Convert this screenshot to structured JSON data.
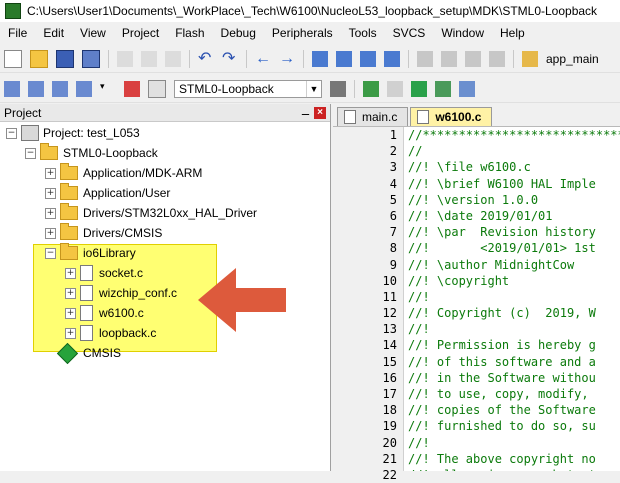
{
  "title": "C:\\Users\\User1\\Documents\\_WorkPlace\\_Tech\\W6100\\NucleoL53_loopback_setup\\MDK\\STML0-Loopback",
  "menu": [
    "File",
    "Edit",
    "View",
    "Project",
    "Flash",
    "Debug",
    "Peripherals",
    "Tools",
    "SVCS",
    "Window",
    "Help"
  ],
  "toolbar": {
    "function_label": "app_main"
  },
  "target": {
    "selected": "STML0-Loopback"
  },
  "panel": {
    "title": "Project",
    "pin": "\u0001",
    "close": "x"
  },
  "tree": {
    "project": "Project: test_L053",
    "target": "STML0-Loopback",
    "groups": [
      "Application/MDK-ARM",
      "Application/User",
      "Drivers/STM32L0xx_HAL_Driver",
      "Drivers/CMSIS",
      "io6Library"
    ],
    "files": [
      "socket.c",
      "wizchip_conf.c",
      "w6100.c",
      "loopback.c"
    ],
    "cmsis": "CMSIS"
  },
  "tabs": [
    "main.c",
    "w6100.c"
  ],
  "editor": {
    "lines": [
      {
        "n": "1",
        "t": "//*****************************"
      },
      {
        "n": "2",
        "t": "//"
      },
      {
        "n": "3",
        "t": "//! \\file w6100.c"
      },
      {
        "n": "4",
        "t": "//! \\brief W6100 HAL Imple"
      },
      {
        "n": "5",
        "t": "//! \\version 1.0.0"
      },
      {
        "n": "6",
        "t": "//! \\date 2019/01/01"
      },
      {
        "n": "7",
        "t": "//! \\par  Revision history"
      },
      {
        "n": "8",
        "t": "//!       <2019/01/01> 1st"
      },
      {
        "n": "9",
        "t": "//! \\author MidnightCow"
      },
      {
        "n": "10",
        "t": "//! \\copyright"
      },
      {
        "n": "11",
        "t": "//!"
      },
      {
        "n": "12",
        "t": "//! Copyright (c)  2019, W"
      },
      {
        "n": "13",
        "t": "//!"
      },
      {
        "n": "14",
        "t": "//! Permission is hereby g"
      },
      {
        "n": "15",
        "t": "//! of this software and a"
      },
      {
        "n": "16",
        "t": "//! in the Software withou"
      },
      {
        "n": "17",
        "t": "//! to use, copy, modify, "
      },
      {
        "n": "18",
        "t": "//! copies of the Software"
      },
      {
        "n": "19",
        "t": "//! furnished to do so, su"
      },
      {
        "n": "20",
        "t": "//!"
      },
      {
        "n": "21",
        "t": "//! The above copyright no"
      },
      {
        "n": "22",
        "t": "//! all copies or substant"
      }
    ]
  },
  "colors": {
    "highlight": "#ffff3c",
    "arrow": "#dd5a3c",
    "comment": "#0b7a0b",
    "active_tab": "#fff2a6"
  }
}
